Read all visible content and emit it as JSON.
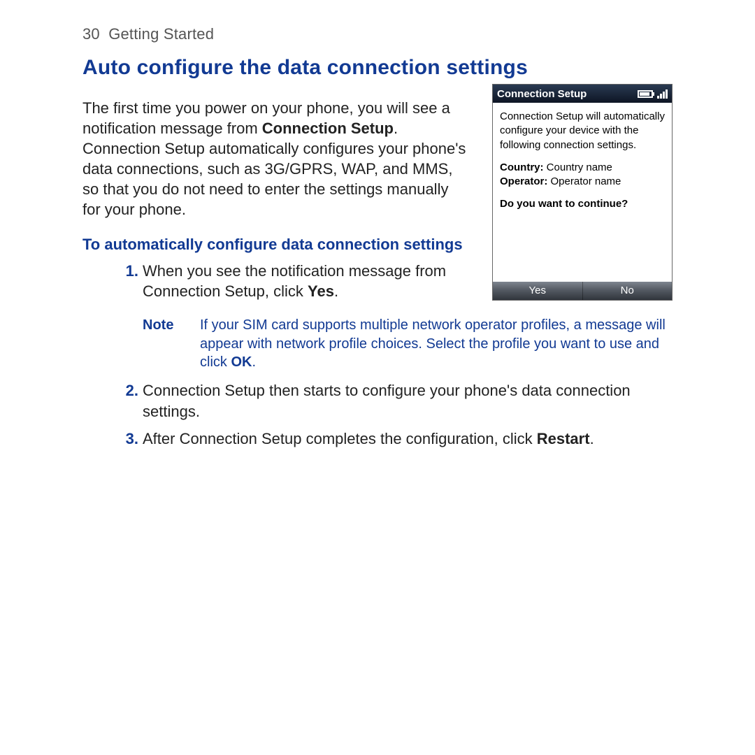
{
  "page": {
    "number": "30",
    "section": "Getting Started"
  },
  "heading": "Auto configure the data connection settings",
  "intro": {
    "t1": "The first time you power on your phone, you will see a notification message from ",
    "b1": "Connection Setup",
    "t2": ". Connection Setup automatically configures your phone's data connections, such as 3G/GPRS, WAP, and MMS, so that you do not need to enter the settings manually for your phone."
  },
  "subheading": "To automatically configure data connection settings",
  "steps": {
    "s1": {
      "num": "1.",
      "t1": "When you see the notification message from Connection Setup, click ",
      "b1": "Yes",
      "t2": "."
    },
    "s2": {
      "num": "2.",
      "t1": "Connection Setup then starts to configure your phone's data connection settings."
    },
    "s3": {
      "num": "3.",
      "t1": "After Connection Setup completes the configuration, click ",
      "b1": "Restart",
      "t2": "."
    }
  },
  "note": {
    "label": "Note",
    "t1": "If your SIM card supports multiple network operator profiles, a message will appear with network profile choices. Select the profile you want to use and click ",
    "b1": "OK",
    "t2": "."
  },
  "phone": {
    "title": "Connection Setup",
    "msg": "Connection Setup will automatically configure your device with the following connection settings.",
    "country_label": "Country:",
    "country_value": "Country name",
    "operator_label": "Operator:",
    "operator_value": "Operator name",
    "question": "Do you want to continue?",
    "yes": "Yes",
    "no": "No"
  }
}
